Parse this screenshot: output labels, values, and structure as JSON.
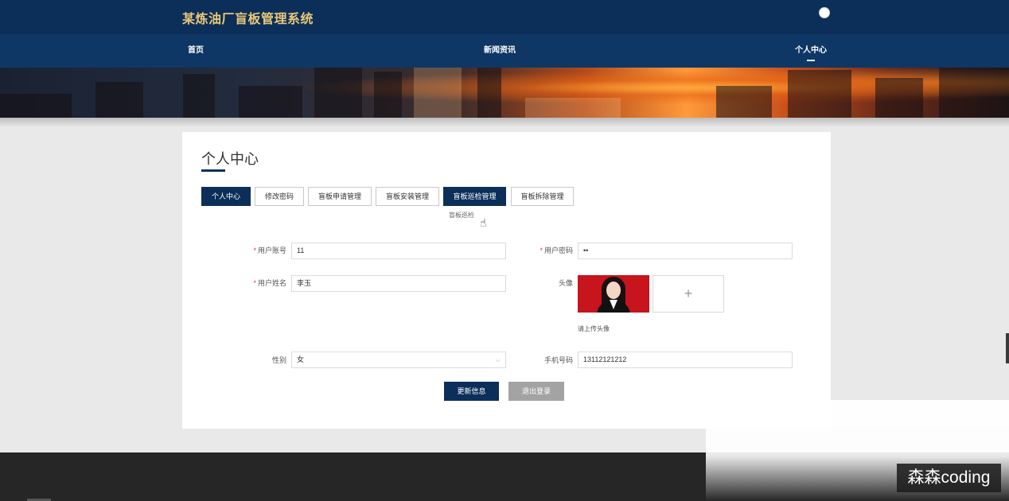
{
  "header": {
    "site_title": "某炼油厂盲板管理系统",
    "user_icon": "user-avatar-icon"
  },
  "nav": {
    "items": [
      {
        "label": "首页"
      },
      {
        "label": "新闻资讯"
      },
      {
        "label": "个人中心"
      }
    ],
    "active_index": 2
  },
  "page": {
    "title": "个人中心"
  },
  "tabs": {
    "items": [
      {
        "label": "个人中心"
      },
      {
        "label": "修改密码"
      },
      {
        "label": "盲板申请管理"
      },
      {
        "label": "盲板安装管理"
      },
      {
        "label": "盲板巡检管理"
      },
      {
        "label": "盲板拆除管理"
      }
    ],
    "active_indices": [
      0,
      4
    ],
    "dropdown_item": "盲板巡检"
  },
  "form": {
    "username": {
      "label": "用户账号",
      "value": "11"
    },
    "password": {
      "label": "用户密码",
      "value": "••"
    },
    "fullname": {
      "label": "用户姓名",
      "value": "李玉"
    },
    "avatar": {
      "label": "头像",
      "upload_symbol": "+",
      "hint": "请上传头像"
    },
    "gender": {
      "label": "性别",
      "value": "女",
      "arrow": "⌵"
    },
    "phone": {
      "label": "手机号码",
      "value": "13112121212"
    }
  },
  "buttons": {
    "update": "更新信息",
    "logout": "退出登录"
  },
  "watermark": "森森coding",
  "colors": {
    "primary": "#0c2f5a",
    "title_gold": "#e8c877",
    "logout_gray": "#a3a3a3",
    "required_red": "#e4393c"
  }
}
